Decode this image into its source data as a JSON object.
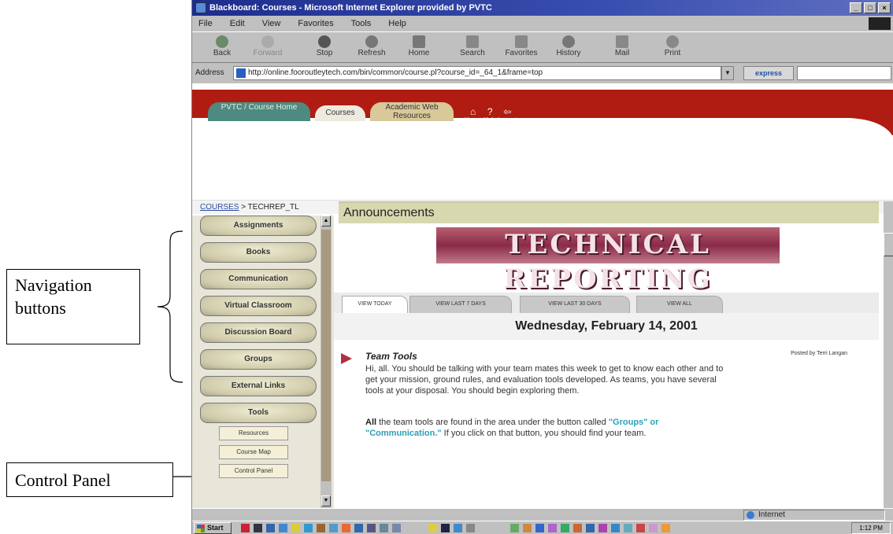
{
  "callouts": {
    "navigation": "Navigation buttons",
    "control_panel": "Control Panel"
  },
  "window": {
    "title": "Blackboard: Courses - Microsoft Internet Explorer provided by PVTC"
  },
  "menu": [
    "File",
    "Edit",
    "View",
    "Favorites",
    "Tools",
    "Help"
  ],
  "toolbar": [
    "Back",
    "Forward",
    "Stop",
    "Refresh",
    "Home",
    "Search",
    "Favorites",
    "History",
    "Mail",
    "Print"
  ],
  "address": {
    "label": "Address",
    "url": "http://online.fooroutleytech.com/bin/common/course.pl?course_id=_64_1&frame=top",
    "express": "express"
  },
  "site_tabs": {
    "home": "PVTC / Course Home",
    "courses": "Courses",
    "academic": "Academic Web Resources"
  },
  "top_icons": [
    "Home",
    "Help",
    "Logout"
  ],
  "breadcrumb": {
    "link": "COURSES",
    "current": " > TECHREP_TL"
  },
  "nav_buttons": [
    "Assignments",
    "Books",
    "Communication",
    "Virtual Classroom",
    "Discussion Board",
    "Groups",
    "External Links",
    "Tools"
  ],
  "tool_buttons": [
    "Resources",
    "Course Map",
    "Control Panel"
  ],
  "main": {
    "header": "Announcements",
    "banner": "TECHNICAL REPORTING",
    "tabs": [
      "VIEW TODAY",
      "VIEW LAST 7 DAYS",
      "VIEW LAST 30 DAYS",
      "VIEW ALL"
    ],
    "date": "Wednesday, February 14, 2001",
    "post": {
      "title": "Team Tools",
      "poster": "Posted by Terri Langan",
      "body": "Hi, all. You should be talking with your team mates this week to get to know each other and to get your mission, ground rules, and evaluation tools developed. As teams, you have several tools at your disposal. You should begin exploring them.",
      "body2_bold": "All",
      "body2_pre": " the team tools are found in the area under the button called ",
      "body2_hl1": "\"Groups\" or \"Communication.\"",
      "body2_post": " If you click on that button, you should find your team."
    }
  },
  "status": {
    "zone": "Internet"
  },
  "taskbar": {
    "start": "Start",
    "clock": "1:12 PM"
  }
}
